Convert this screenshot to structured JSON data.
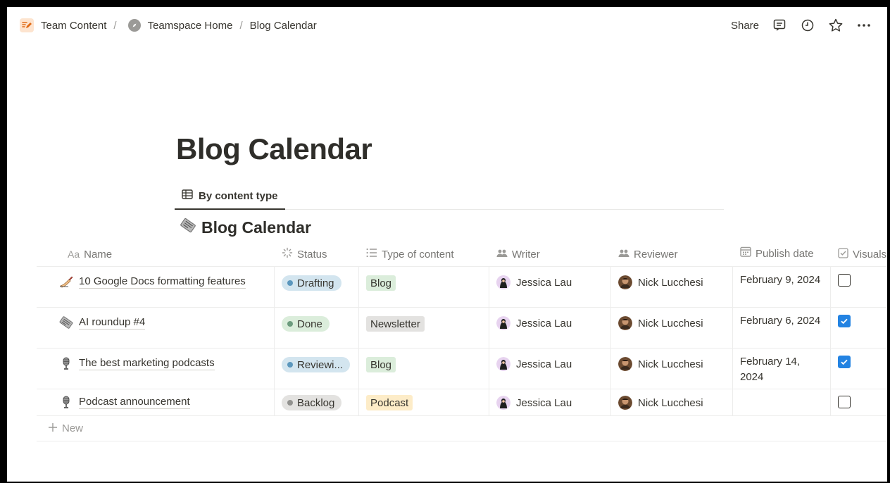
{
  "breadcrumb": {
    "items": [
      "Team Content",
      "Teamspace Home",
      "Blog Calendar"
    ],
    "separator": "/"
  },
  "actions": {
    "share_label": "Share",
    "icons": [
      "comment-icon",
      "history-icon",
      "star-icon",
      "more-icon"
    ]
  },
  "page": {
    "title": "Blog Calendar"
  },
  "view_tab": {
    "label": "By content type",
    "icon": "table-icon"
  },
  "database": {
    "title": "Blog Calendar",
    "icon": "newspaper-icon"
  },
  "columns": {
    "name": "Name",
    "name_prefix": "Aa",
    "status": "Status",
    "type": "Type of content",
    "writer": "Writer",
    "reviewer": "Reviewer",
    "publish_date": "Publish date",
    "visuals": "Visuals"
  },
  "rows": [
    {
      "icon": "writing-hand-icon",
      "name": "10 Google Docs formatting features",
      "status": "Drafting",
      "type": "Blog",
      "writer": "Jessica Lau",
      "reviewer": "Nick Lucchesi",
      "date": "February 9, 2024",
      "visuals": false
    },
    {
      "icon": "newspaper-icon",
      "name": "AI roundup #4",
      "status": "Done",
      "type": "Newsletter",
      "writer": "Jessica Lau",
      "reviewer": "Nick Lucchesi",
      "date": "February 6, 2024",
      "visuals": true
    },
    {
      "icon": "microphone-icon",
      "name": "The best marketing podcasts",
      "status": "Reviewi...",
      "type": "Blog",
      "writer": "Jessica Lau",
      "reviewer": "Nick Lucchesi",
      "date": "February 14, 2024",
      "visuals": true
    },
    {
      "icon": "microphone-icon",
      "name": "Podcast announcement",
      "status": "Backlog",
      "type": "Podcast",
      "writer": "Jessica Lau",
      "reviewer": "Nick Lucchesi",
      "date": "",
      "visuals": false
    }
  ],
  "new_row_label": "New",
  "colors": {
    "status_drafting_bg": "#d3e5ef",
    "status_drafting_dot": "#5b97bd",
    "status_done_bg": "#dbeddb",
    "status_done_dot": "#6c9b7d",
    "status_review_bg": "#d3e5ef",
    "status_review_dot": "#5b97bd",
    "status_backlog_bg": "#e3e2e0",
    "status_backlog_dot": "#91918e",
    "tag_blog": "#dbeddb",
    "tag_newsletter": "#e3e2e0",
    "tag_podcast": "#fdecc8",
    "checkbox_checked": "#2383e2"
  }
}
